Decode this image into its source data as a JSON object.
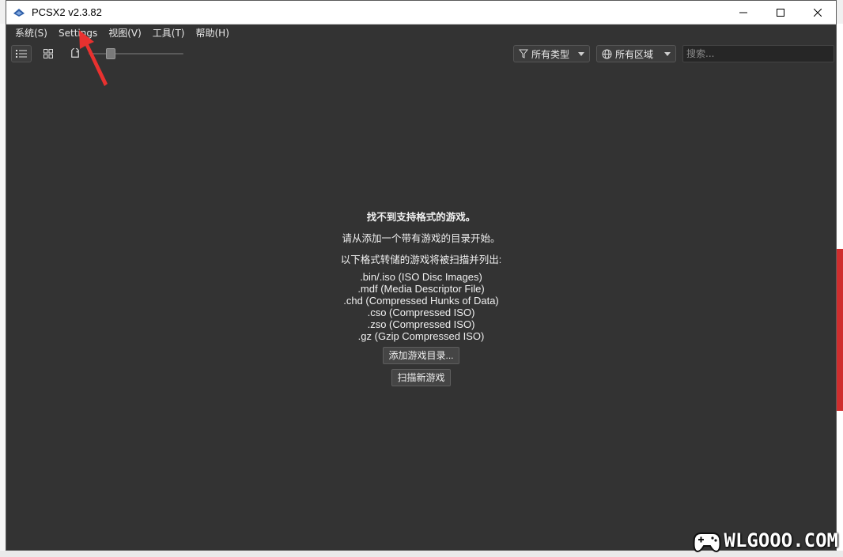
{
  "window": {
    "title": "PCSX2 v2.3.82"
  },
  "menu": [
    {
      "label": "系统(S)"
    },
    {
      "label": "Settings"
    },
    {
      "label": "视图(V)"
    },
    {
      "label": "工具(T)"
    },
    {
      "label": "帮助(H)"
    }
  ],
  "toolbar": {
    "type_filter": "所有类型",
    "region_filter": "所有区域",
    "search_placeholder": "搜索..."
  },
  "empty_state": {
    "heading": "找不到支持格式的游戏。",
    "line1": "请从添加一个带有游戏的目录开始。",
    "line2": "以下格式转储的游戏将被扫描并列出:",
    "formats": [
      ".bin/.iso (ISO Disc Images)",
      ".mdf (Media Descriptor File)",
      ".chd (Compressed Hunks of Data)",
      ".cso (Compressed ISO)",
      ".zso (Compressed ISO)",
      ".gz (Gzip Compressed ISO)"
    ],
    "add_dir_button": "添加游戏目录...",
    "scan_button": "扫描新游戏"
  },
  "watermark": {
    "text": "WLGOOO.COM"
  },
  "colors": {
    "background": "#333333",
    "annotation_arrow": "#e8312f"
  }
}
